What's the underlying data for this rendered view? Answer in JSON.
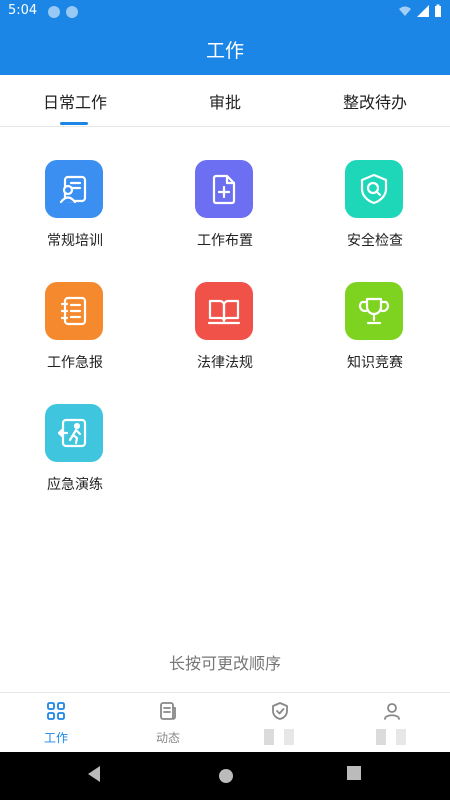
{
  "status_bar": {
    "time": "5:04"
  },
  "app_bar": {
    "title": "工作"
  },
  "tabs": [
    {
      "label": "日常工作",
      "active": true
    },
    {
      "label": "审批",
      "active": false
    },
    {
      "label": "整改待办",
      "active": false
    }
  ],
  "grid": [
    {
      "label": "常规培训",
      "icon": "training-icon",
      "color": "#3b8ff0"
    },
    {
      "label": "工作布置",
      "icon": "document-add-icon",
      "color": "#6c6ff2"
    },
    {
      "label": "安全检查",
      "icon": "shield-search-icon",
      "color": "#1ed7b8"
    },
    {
      "label": "工作急报",
      "icon": "notebook-icon",
      "color": "#f5892e"
    },
    {
      "label": "法律法规",
      "icon": "book-icon",
      "color": "#f05249"
    },
    {
      "label": "知识竞赛",
      "icon": "trophy-icon",
      "color": "#7ed321"
    },
    {
      "label": "应急演练",
      "icon": "emergency-exit-icon",
      "color": "#3fc6de"
    }
  ],
  "hint": "长按可更改顺序",
  "bottom_nav": [
    {
      "label": "工作",
      "icon": "grid-icon",
      "active": true
    },
    {
      "label": "动态",
      "icon": "document-icon",
      "active": false
    },
    {
      "label": "",
      "icon": "shield-check-icon",
      "active": false
    },
    {
      "label": "",
      "icon": "user-icon",
      "active": false
    }
  ],
  "colors": {
    "primary": "#1b86e6",
    "text": "#222222",
    "muted": "#888888"
  }
}
